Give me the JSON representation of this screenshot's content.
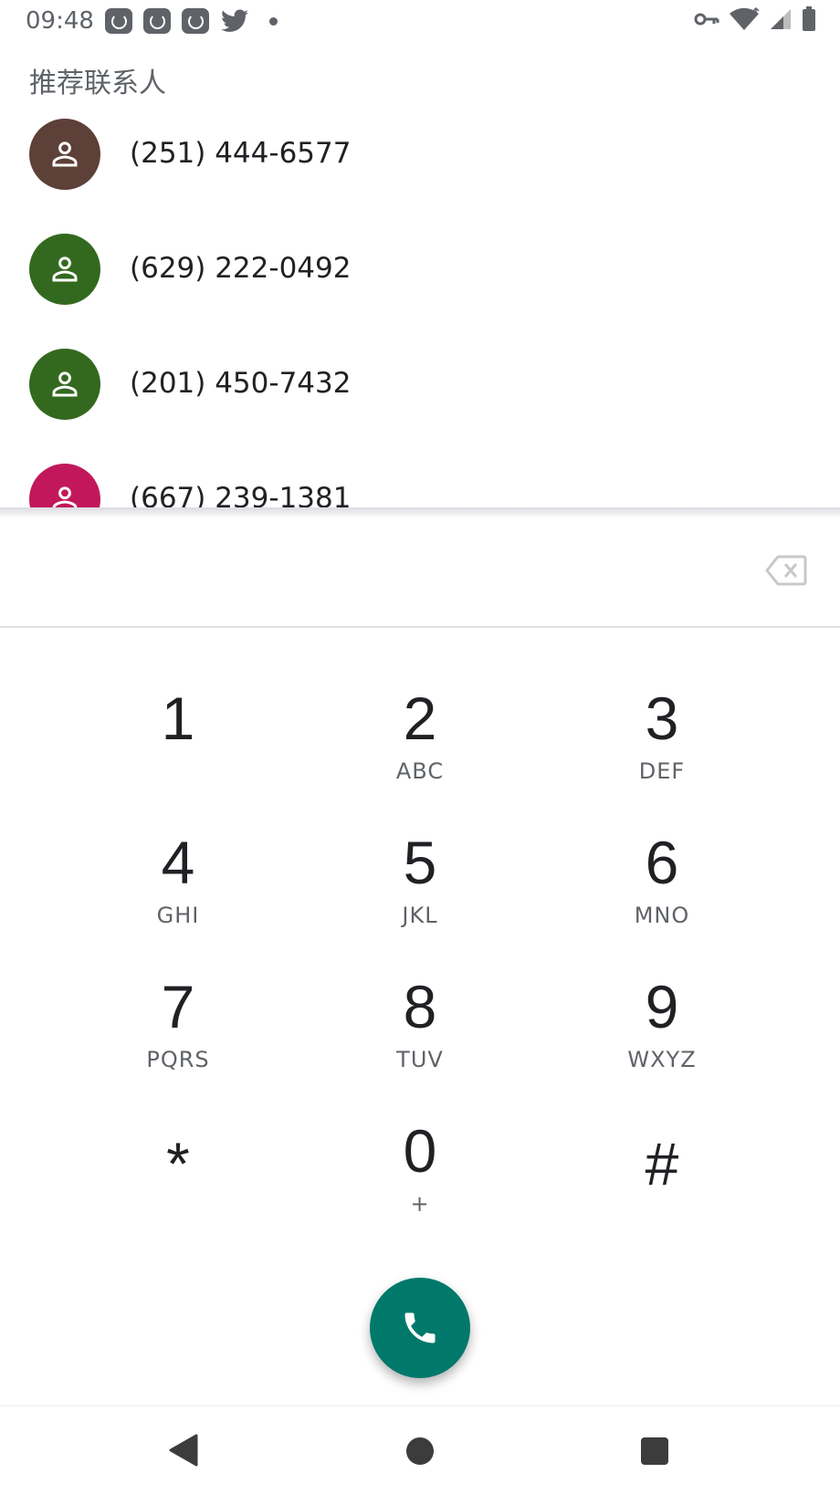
{
  "status_bar": {
    "time": "09:48",
    "icons": [
      "app-notification-icon",
      "app-notification-icon",
      "app-notification-icon",
      "twitter-icon",
      "more-notifications-dot",
      "vpn-key-icon",
      "wifi-icon",
      "signal-icon",
      "battery-icon"
    ]
  },
  "suggested": {
    "title": "推荐联系人",
    "contacts": [
      {
        "number": "(251) 444-6577",
        "color": "#5d4037"
      },
      {
        "number": "(629) 222-0492",
        "color": "#33691e"
      },
      {
        "number": "(201) 450-7432",
        "color": "#33691e"
      },
      {
        "number": "(667) 239-1381",
        "color": "#c2185b"
      }
    ]
  },
  "dialpad": {
    "entered_digits": "",
    "keys": [
      {
        "digit": "1",
        "letters": ""
      },
      {
        "digit": "2",
        "letters": "ABC"
      },
      {
        "digit": "3",
        "letters": "DEF"
      },
      {
        "digit": "4",
        "letters": "GHI"
      },
      {
        "digit": "5",
        "letters": "JKL"
      },
      {
        "digit": "6",
        "letters": "MNO"
      },
      {
        "digit": "7",
        "letters": "PQRS"
      },
      {
        "digit": "8",
        "letters": "TUV"
      },
      {
        "digit": "9",
        "letters": "WXYZ"
      },
      {
        "digit": "*",
        "letters": ""
      },
      {
        "digit": "0",
        "letters": "+"
      },
      {
        "digit": "#",
        "letters": ""
      }
    ]
  },
  "colors": {
    "call_button": "#00796b",
    "secondary_text": "#5f6368"
  }
}
